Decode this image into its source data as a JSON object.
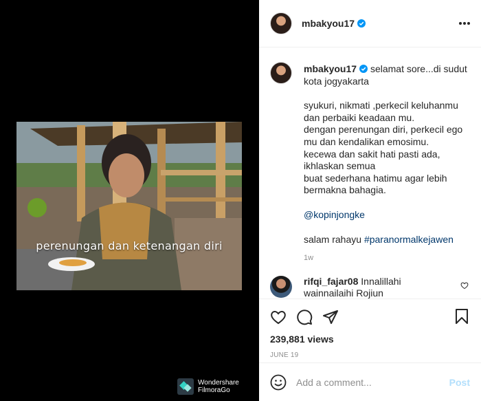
{
  "media": {
    "caption": "perenungan dan ketenangan diri",
    "watermark_line1": "Wondershare",
    "watermark_line2": "FilmoraGo"
  },
  "header": {
    "username": "mbakyou17",
    "verified": true
  },
  "post": {
    "username": "mbakyou17",
    "caption_line1": "selamat sore...di sudut kota jogyakarta",
    "paragraph": "syukuri, nikmati ,perkecil keluhanmu\ndan perbaiki keadaan mu.\ndengan perenungan diri, perkecil ego\nmu dan kendalikan emosimu.\nkecewa dan sakit hati pasti ada,\nikhlaskan semua\nbuat sederhana hatimu agar lebih\nbermakna bahagia.",
    "mention": "@kopinjongke",
    "closing_text": "salam rahayu",
    "hashtag": "#paranormalkejawen",
    "time": "1w"
  },
  "comment": {
    "username": "rifqi_fajar08",
    "text": "Innalillahi wainnailaihi Rojiun"
  },
  "stats": {
    "views": "239,881 views",
    "date": "JUNE 19"
  },
  "add_comment": {
    "placeholder": "Add a comment...",
    "post_label": "Post"
  },
  "colors": {
    "accent_blue": "#0095f6",
    "post_disabled": "#b2dffc",
    "link": "#00376b",
    "secondary_text": "#8e8e8e"
  }
}
